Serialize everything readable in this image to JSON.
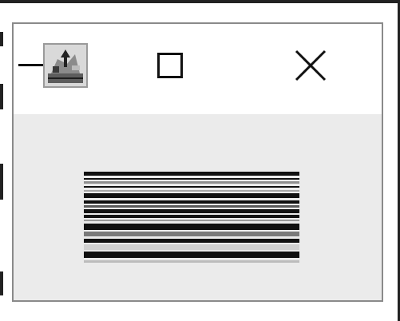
{
  "window": {
    "title_icons": {
      "minimize": "minimize-icon",
      "app": "app-icon",
      "maximize": "maximize-icon",
      "close": "close-icon"
    }
  },
  "content": {
    "graphic": "barcode-like-graphic"
  },
  "colors": {
    "window_border": "#8a8a8a",
    "titlebar_bg": "#ffffff",
    "content_bg": "#ebebeb",
    "icon_stroke": "#111111"
  }
}
